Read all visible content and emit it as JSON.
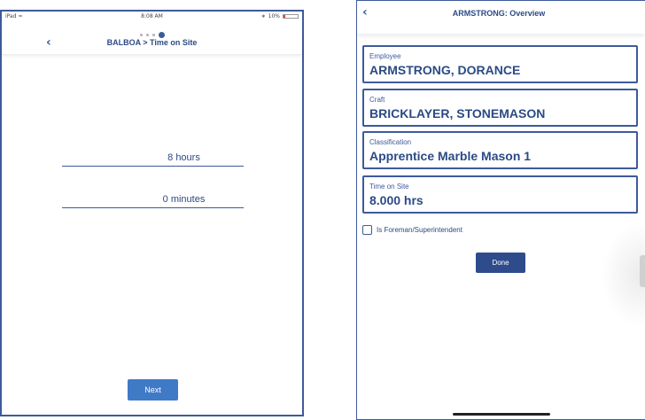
{
  "left_screen": {
    "status_bar": {
      "carrier": "iPad",
      "time": "8:08 AM",
      "battery_percent": "10%",
      "battery_level": 0.1
    },
    "page_indicator": {
      "count": 4,
      "active_index": 3
    },
    "nav": {
      "back_icon": "chevron-left-icon",
      "title": "BALBOA > Time on Site"
    },
    "hours_value": "8 hours",
    "minutes_value": "0 minutes",
    "next_label": "Next"
  },
  "right_screen": {
    "nav": {
      "back_icon": "chevron-left-icon",
      "title": "ARMSTRONG: Overview"
    },
    "fields": [
      {
        "label": "Employee",
        "value": "ARMSTRONG, DORANCE"
      },
      {
        "label": "Craft",
        "value": "BRICKLAYER, STONEMASON"
      },
      {
        "label": "Classification",
        "value": "Apprentice Marble Mason 1"
      },
      {
        "label": "Time on Site",
        "value": "8.000 hrs"
      }
    ],
    "foreman_checkbox": {
      "label": "Is Foreman/Superintendent",
      "checked": false
    },
    "done_label": "Done"
  },
  "colors": {
    "primary": "#3d5a9c",
    "text": "#2b4a85",
    "next_button": "#3f7ac7",
    "done_button": "#2e4c8c"
  }
}
